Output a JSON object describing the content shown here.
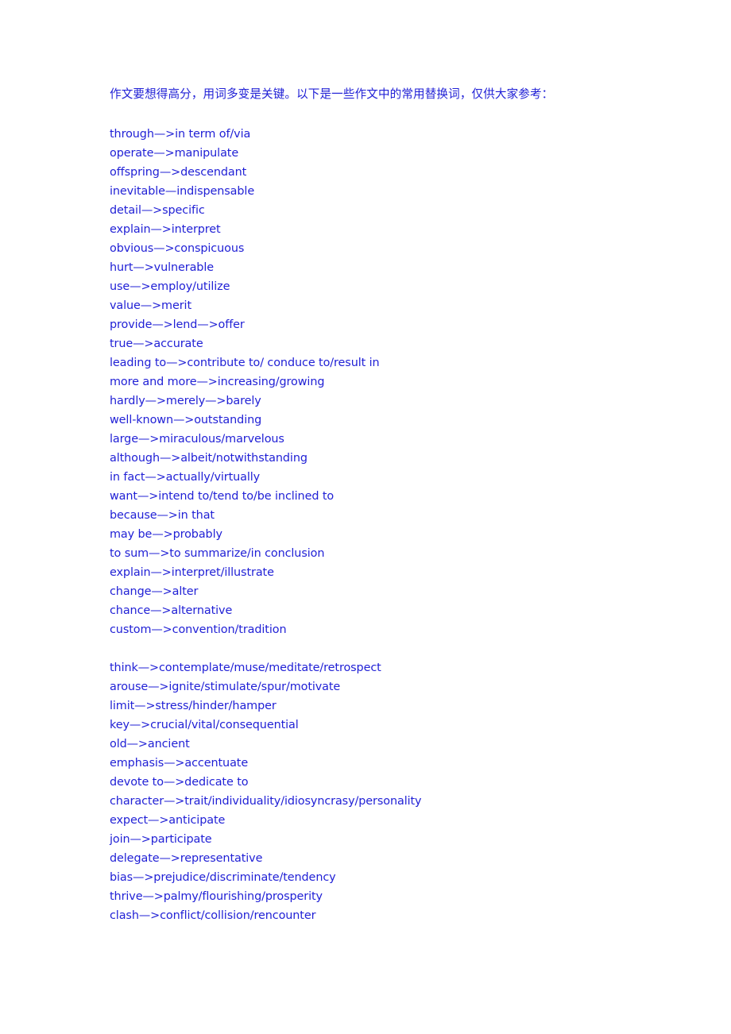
{
  "document": {
    "page_background": "#ffffff",
    "text_color": "#2121d6",
    "header": "作文要想得高分，用词多变是关键。以下是一些作文中的常用替换词，仅供大家参考：",
    "blocks": [
      {
        "name": "substitution-block-1",
        "entries": [
          "through—>in term of/via",
          "operate—>manipulate",
          "offspring—>descendant",
          "inevitable—indispensable",
          "detail—>specific",
          "explain—>interpret",
          "obvious—>conspicuous",
          "hurt—>vulnerable",
          "use—>employ/utilize",
          "value—>merit",
          "provide—>lend—>offer",
          "true—>accurate",
          "leading to—>contribute to/ conduce to/result in",
          "more and more—>increasing/growing",
          "hardly—>merely—>barely",
          "well-known—>outstanding",
          "large—>miraculous/marvelous",
          "although—>albeit/notwithstanding",
          "in fact—>actually/virtually",
          "want—>intend to/tend to/be inclined to",
          "because—>in that",
          "may be—>probably",
          "to sum—>to summarize/in conclusion",
          "explain—>interpret/illustrate",
          "change—>alter",
          "chance—>alternative",
          "custom—>convention/tradition"
        ]
      },
      {
        "name": "substitution-block-2",
        "entries": [
          "think—>contemplate/muse/meditate/retrospect",
          "arouse—>ignite/stimulate/spur/motivate",
          "limit—>stress/hinder/hamper",
          "key—>crucial/vital/consequential",
          "old—>ancient",
          "emphasis—>accentuate",
          "devote to—>dedicate to",
          "character—>trait/individuality/idiosyncrasy/personality",
          "expect—>anticipate",
          "join—>participate",
          "delegate—>representative",
          "bias—>prejudice/discriminate/tendency",
          "thrive—>palmy/flourishing/prosperity",
          "clash—>conflict/collision/rencounter"
        ]
      }
    ]
  }
}
